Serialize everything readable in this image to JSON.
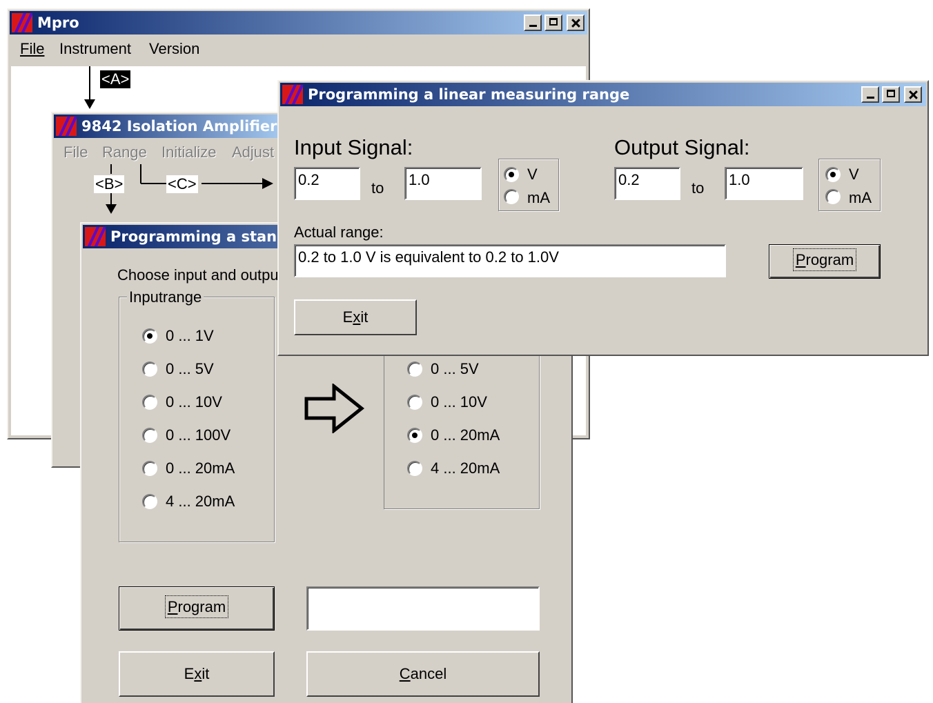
{
  "main_window": {
    "title": "Mpro",
    "menu": [
      "File",
      "Instrument",
      "Version"
    ]
  },
  "instrument_window": {
    "title": "9842 Isolation Amplifier",
    "menu": [
      "File",
      "Range",
      "Initialize",
      "Adjust"
    ]
  },
  "annotations": {
    "a": "<A>",
    "b": "<B>",
    "c": "<C>"
  },
  "standard_dialog": {
    "title": "Programming a stand",
    "instruction": "Choose input and output",
    "input_group": "Inputrange",
    "input_options": [
      "0 ... 1V",
      "0 ... 5V",
      "0 ... 10V",
      "0 ... 100V",
      "0 ... 20mA",
      "4 ... 20mA"
    ],
    "input_selected": 0,
    "output_options": [
      "0 ... 5V",
      "0 ... 10V",
      "0 ... 20mA",
      "4 ... 20mA"
    ],
    "output_selected": 2,
    "program_button": "Program",
    "exit_button": "Exit",
    "cancel_button": "Cancel",
    "status_value": ""
  },
  "linear_dialog": {
    "title": "Programming a linear measuring range",
    "input_signal_label": "Input Signal:",
    "output_signal_label": "Output Signal:",
    "to_label": "to",
    "input_from": "0.2",
    "input_to": "1.0",
    "output_from": "0.2",
    "output_to": "1.0",
    "unit_options": [
      "V",
      "mA"
    ],
    "input_unit_selected": "V",
    "output_unit_selected": "V",
    "actual_range_label": "Actual range:",
    "actual_range_value": "0.2 to 1.0 V is equivalent to 0.2 to 1.0V",
    "program_button": "Program",
    "exit_button": "Exit"
  },
  "icons": [
    "app-icon",
    "minimize-icon",
    "maximize-icon",
    "close-icon",
    "arrow-right-icon"
  ]
}
